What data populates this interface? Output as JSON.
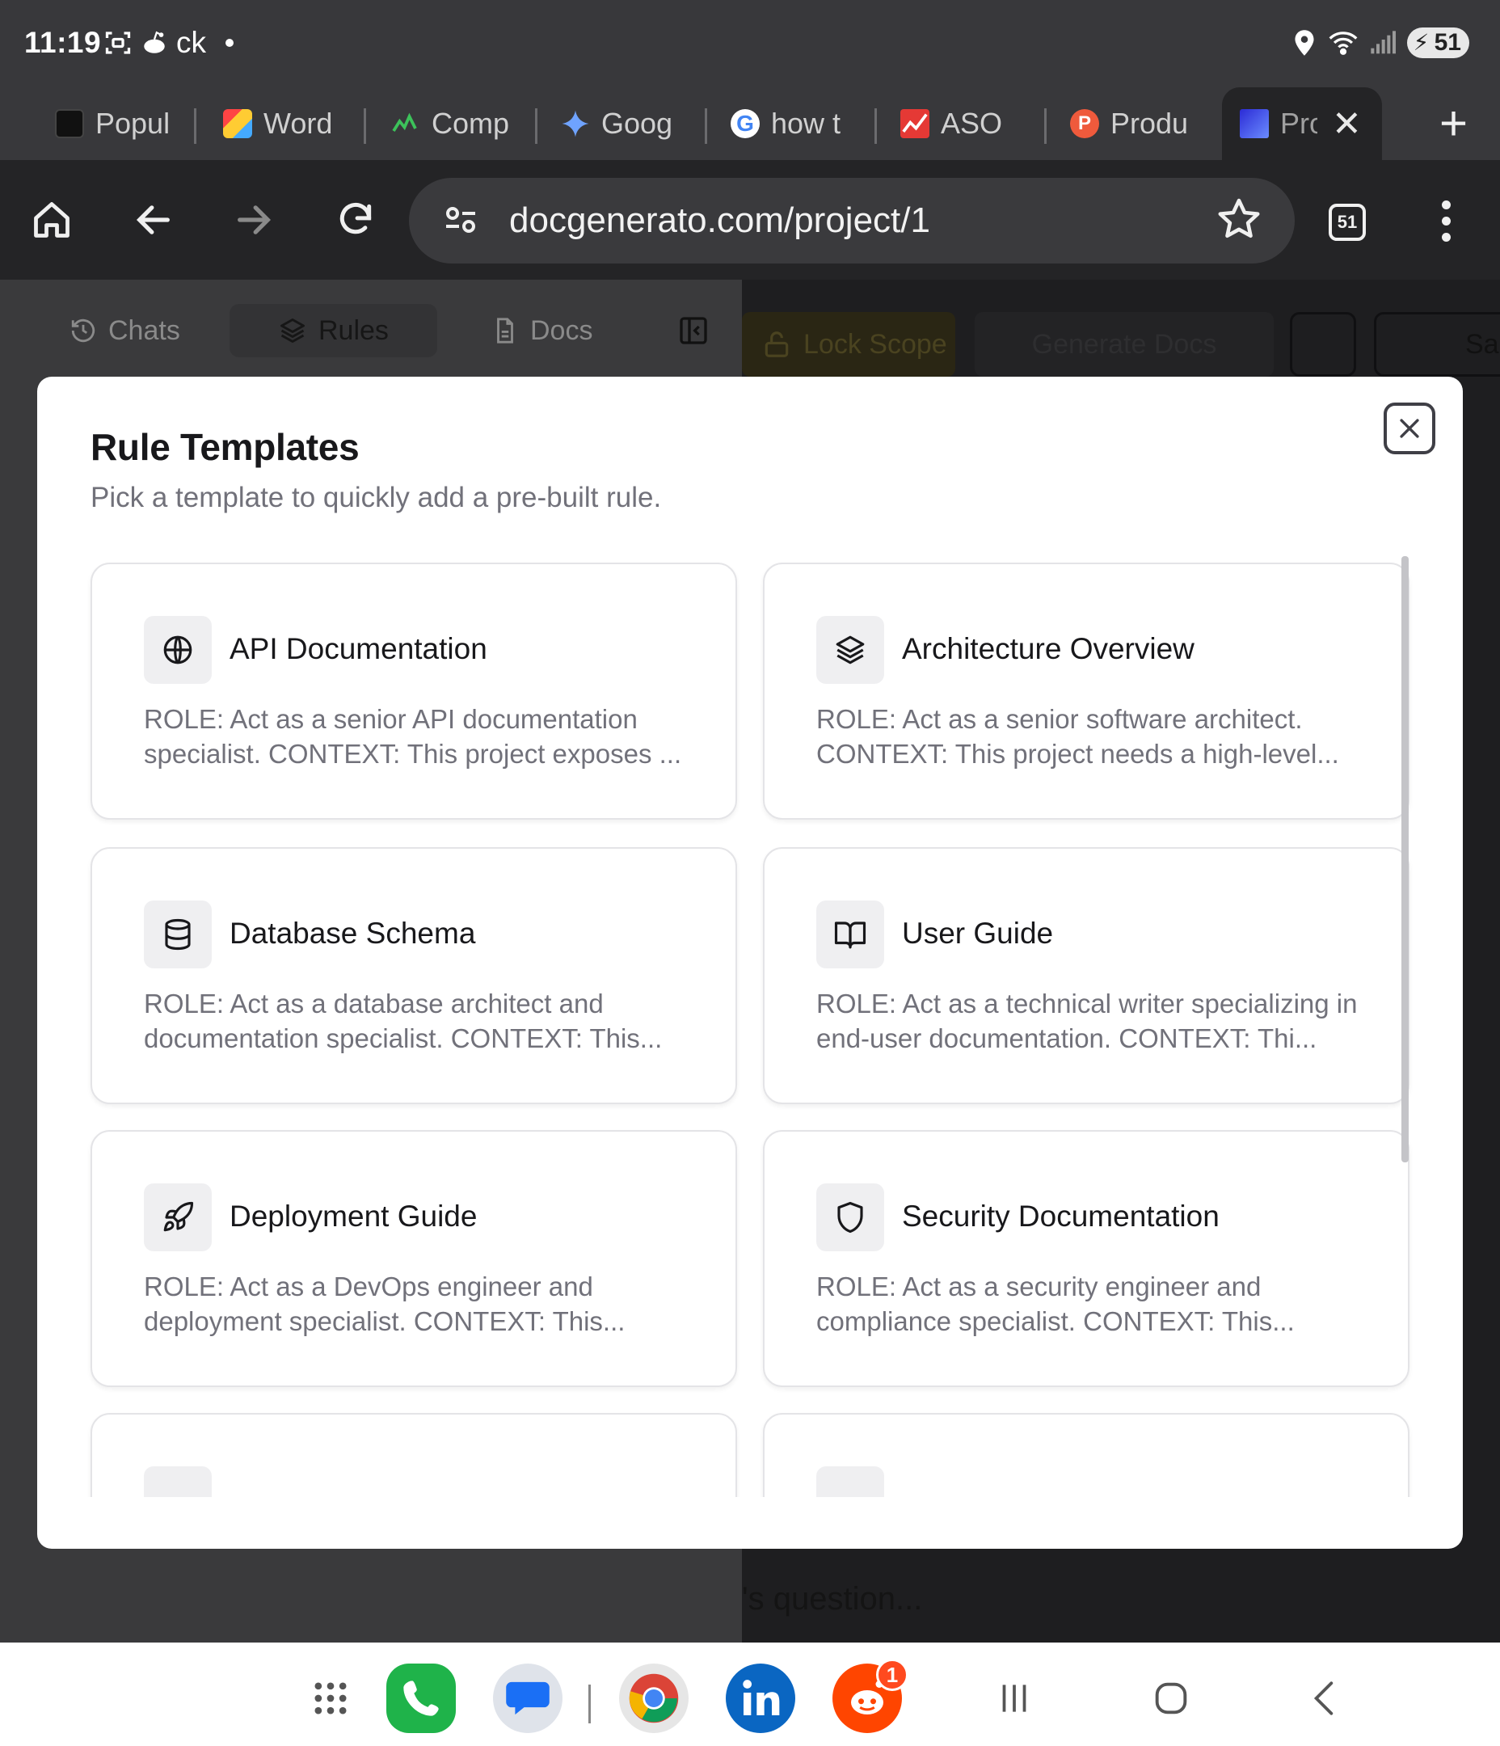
{
  "status_bar": {
    "time": "11:19",
    "notif_text": "ck",
    "battery": "51"
  },
  "tabs": [
    {
      "label": "Popul",
      "favicon": "popular-favicon",
      "color": "#222222"
    },
    {
      "label": "Word",
      "favicon": "word-favicon",
      "color": "#e05a5a"
    },
    {
      "label": "Comp",
      "favicon": "comp-favicon",
      "color": "#2aa84a"
    },
    {
      "label": "Goog",
      "favicon": "gemini-favicon",
      "color": "#5b8cff"
    },
    {
      "label": "how t",
      "favicon": "google-favicon",
      "color": "#ffffff"
    },
    {
      "label": "ASO",
      "favicon": "aso-favicon",
      "color": "#e53935"
    },
    {
      "label": "Produ",
      "favicon": "producthunt-favicon",
      "color": "#ef5a3c"
    },
    {
      "label": "Pro",
      "favicon": "project-favicon",
      "color": "#3d3ae0"
    }
  ],
  "toolbar": {
    "url": "docgenerato.com/project/1",
    "tab_count": "51"
  },
  "background_app": {
    "tabs": [
      {
        "label": "Chats"
      },
      {
        "label": "Rules"
      },
      {
        "label": "Docs"
      }
    ],
    "lock_scope": "Lock Scope",
    "generate_docs": "Generate Docs",
    "save": "Sa",
    "question_placeholder": "'s question..."
  },
  "modal": {
    "title": "Rule Templates",
    "subtitle": "Pick a template to quickly add a pre-built rule.",
    "templates": [
      {
        "title": "API Documentation",
        "icon": "globe-icon",
        "description": "ROLE: Act as a senior API documentation specialist. CONTEXT: This project exposes ..."
      },
      {
        "title": "Architecture Overview",
        "icon": "layers-icon",
        "description": "ROLE: Act as a senior software architect. CONTEXT: This project needs a high-level..."
      },
      {
        "title": "Database Schema",
        "icon": "database-icon",
        "description": "ROLE: Act as a database architect and documentation specialist. CONTEXT: This..."
      },
      {
        "title": "User Guide",
        "icon": "book-open-icon",
        "description": "ROLE: Act as a technical writer specializing in end-user documentation. CONTEXT: Thi..."
      },
      {
        "title": "Deployment Guide",
        "icon": "rocket-icon",
        "description": "ROLE: Act as a DevOps engineer and deployment specialist. CONTEXT: This..."
      },
      {
        "title": "Security Documentation",
        "icon": "shield-icon",
        "description": "ROLE: Act as a security engineer and compliance specialist. CONTEXT: This..."
      }
    ]
  },
  "dock": {
    "badge_count": "1",
    "apps": [
      "app-drawer-icon",
      "phone-icon",
      "messages-icon",
      "chrome-icon",
      "linkedin-icon",
      "reddit-icon"
    ]
  }
}
